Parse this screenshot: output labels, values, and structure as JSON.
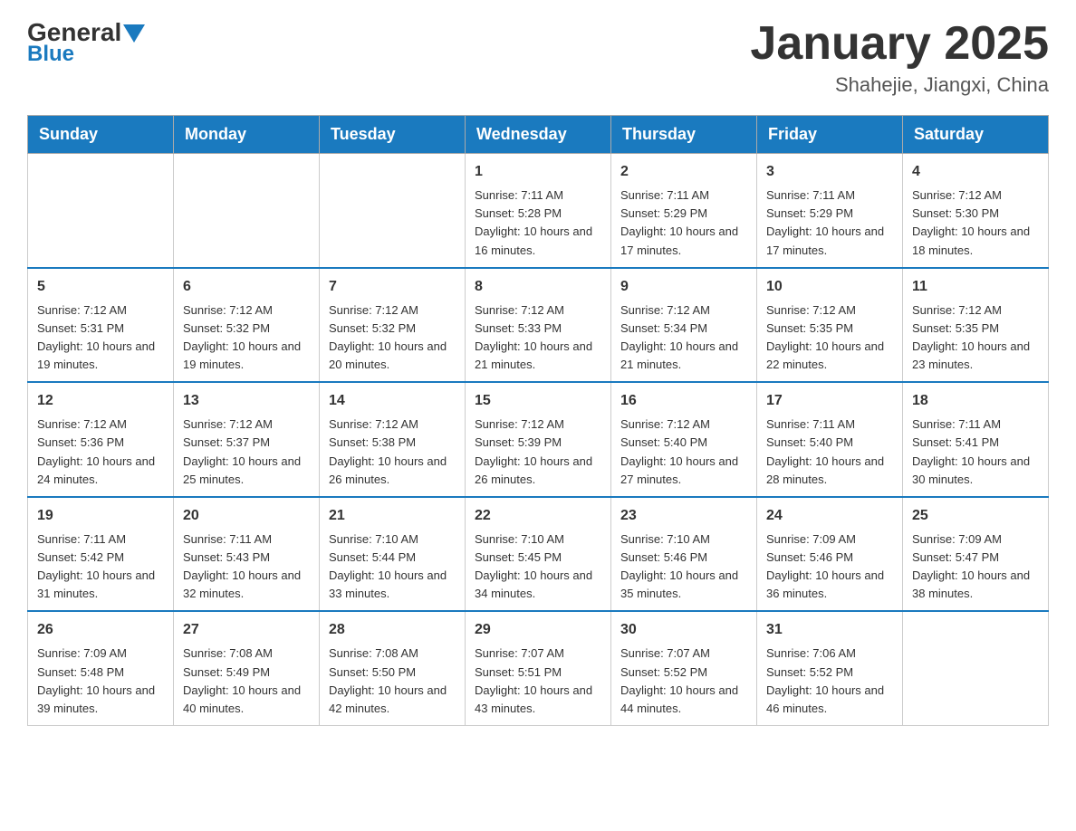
{
  "header": {
    "logo": {
      "general": "General",
      "blue": "Blue"
    },
    "title": "January 2025",
    "location": "Shahejie, Jiangxi, China"
  },
  "days_of_week": [
    "Sunday",
    "Monday",
    "Tuesday",
    "Wednesday",
    "Thursday",
    "Friday",
    "Saturday"
  ],
  "weeks": [
    [
      {
        "day": "",
        "info": ""
      },
      {
        "day": "",
        "info": ""
      },
      {
        "day": "",
        "info": ""
      },
      {
        "day": "1",
        "info": "Sunrise: 7:11 AM\nSunset: 5:28 PM\nDaylight: 10 hours and 16 minutes."
      },
      {
        "day": "2",
        "info": "Sunrise: 7:11 AM\nSunset: 5:29 PM\nDaylight: 10 hours and 17 minutes."
      },
      {
        "day": "3",
        "info": "Sunrise: 7:11 AM\nSunset: 5:29 PM\nDaylight: 10 hours and 17 minutes."
      },
      {
        "day": "4",
        "info": "Sunrise: 7:12 AM\nSunset: 5:30 PM\nDaylight: 10 hours and 18 minutes."
      }
    ],
    [
      {
        "day": "5",
        "info": "Sunrise: 7:12 AM\nSunset: 5:31 PM\nDaylight: 10 hours and 19 minutes."
      },
      {
        "day": "6",
        "info": "Sunrise: 7:12 AM\nSunset: 5:32 PM\nDaylight: 10 hours and 19 minutes."
      },
      {
        "day": "7",
        "info": "Sunrise: 7:12 AM\nSunset: 5:32 PM\nDaylight: 10 hours and 20 minutes."
      },
      {
        "day": "8",
        "info": "Sunrise: 7:12 AM\nSunset: 5:33 PM\nDaylight: 10 hours and 21 minutes."
      },
      {
        "day": "9",
        "info": "Sunrise: 7:12 AM\nSunset: 5:34 PM\nDaylight: 10 hours and 21 minutes."
      },
      {
        "day": "10",
        "info": "Sunrise: 7:12 AM\nSunset: 5:35 PM\nDaylight: 10 hours and 22 minutes."
      },
      {
        "day": "11",
        "info": "Sunrise: 7:12 AM\nSunset: 5:35 PM\nDaylight: 10 hours and 23 minutes."
      }
    ],
    [
      {
        "day": "12",
        "info": "Sunrise: 7:12 AM\nSunset: 5:36 PM\nDaylight: 10 hours and 24 minutes."
      },
      {
        "day": "13",
        "info": "Sunrise: 7:12 AM\nSunset: 5:37 PM\nDaylight: 10 hours and 25 minutes."
      },
      {
        "day": "14",
        "info": "Sunrise: 7:12 AM\nSunset: 5:38 PM\nDaylight: 10 hours and 26 minutes."
      },
      {
        "day": "15",
        "info": "Sunrise: 7:12 AM\nSunset: 5:39 PM\nDaylight: 10 hours and 26 minutes."
      },
      {
        "day": "16",
        "info": "Sunrise: 7:12 AM\nSunset: 5:40 PM\nDaylight: 10 hours and 27 minutes."
      },
      {
        "day": "17",
        "info": "Sunrise: 7:11 AM\nSunset: 5:40 PM\nDaylight: 10 hours and 28 minutes."
      },
      {
        "day": "18",
        "info": "Sunrise: 7:11 AM\nSunset: 5:41 PM\nDaylight: 10 hours and 30 minutes."
      }
    ],
    [
      {
        "day": "19",
        "info": "Sunrise: 7:11 AM\nSunset: 5:42 PM\nDaylight: 10 hours and 31 minutes."
      },
      {
        "day": "20",
        "info": "Sunrise: 7:11 AM\nSunset: 5:43 PM\nDaylight: 10 hours and 32 minutes."
      },
      {
        "day": "21",
        "info": "Sunrise: 7:10 AM\nSunset: 5:44 PM\nDaylight: 10 hours and 33 minutes."
      },
      {
        "day": "22",
        "info": "Sunrise: 7:10 AM\nSunset: 5:45 PM\nDaylight: 10 hours and 34 minutes."
      },
      {
        "day": "23",
        "info": "Sunrise: 7:10 AM\nSunset: 5:46 PM\nDaylight: 10 hours and 35 minutes."
      },
      {
        "day": "24",
        "info": "Sunrise: 7:09 AM\nSunset: 5:46 PM\nDaylight: 10 hours and 36 minutes."
      },
      {
        "day": "25",
        "info": "Sunrise: 7:09 AM\nSunset: 5:47 PM\nDaylight: 10 hours and 38 minutes."
      }
    ],
    [
      {
        "day": "26",
        "info": "Sunrise: 7:09 AM\nSunset: 5:48 PM\nDaylight: 10 hours and 39 minutes."
      },
      {
        "day": "27",
        "info": "Sunrise: 7:08 AM\nSunset: 5:49 PM\nDaylight: 10 hours and 40 minutes."
      },
      {
        "day": "28",
        "info": "Sunrise: 7:08 AM\nSunset: 5:50 PM\nDaylight: 10 hours and 42 minutes."
      },
      {
        "day": "29",
        "info": "Sunrise: 7:07 AM\nSunset: 5:51 PM\nDaylight: 10 hours and 43 minutes."
      },
      {
        "day": "30",
        "info": "Sunrise: 7:07 AM\nSunset: 5:52 PM\nDaylight: 10 hours and 44 minutes."
      },
      {
        "day": "31",
        "info": "Sunrise: 7:06 AM\nSunset: 5:52 PM\nDaylight: 10 hours and 46 minutes."
      },
      {
        "day": "",
        "info": ""
      }
    ]
  ]
}
